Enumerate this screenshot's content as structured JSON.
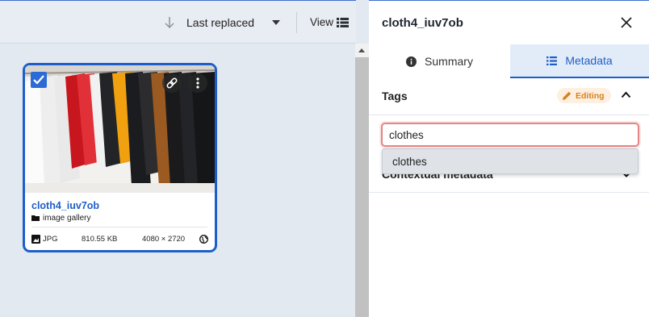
{
  "toolbar": {
    "sort_label": "Last replaced",
    "view_label": "View"
  },
  "asset": {
    "title": "cloth4_iuv7ob",
    "folder": "image gallery",
    "format": "JPG",
    "size": "810.55 KB",
    "dimensions": "4080 × 2720"
  },
  "panel": {
    "title": "cloth4_iuv7ob",
    "tabs": [
      {
        "label": "Summary",
        "icon": "info-icon"
      },
      {
        "label": "Metadata",
        "icon": "list-icon"
      }
    ],
    "tags": {
      "label": "Tags",
      "badge": "Editing",
      "input_value": "clothes",
      "suggestions": [
        "clothes"
      ]
    },
    "contextual_label": "Contextual metadata"
  },
  "colors": {
    "accent": "#1d5fc8",
    "editing": "#d9801c",
    "input_error_border": "#e58484"
  }
}
